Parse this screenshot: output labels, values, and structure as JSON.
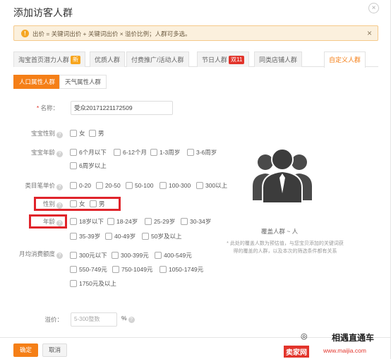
{
  "dialog": {
    "title": "添加访客人群",
    "close_icon": "×"
  },
  "notice": {
    "text": "出价 = 关键词出价 + 关键词出价 × 溢价比例；人群可多选。",
    "close": "×"
  },
  "tabs": [
    {
      "label": "淘宝首页潜力人群",
      "tag": "新",
      "tag_color": "#f7a51d"
    },
    {
      "label": "优质人群"
    },
    {
      "label": "付费推广/活动人群"
    },
    {
      "label": "节日人群",
      "tag": "双11",
      "tag_color": "#e2342b"
    },
    {
      "label": "同类店铺人群"
    },
    {
      "label": "自定义人群",
      "active": true
    }
  ],
  "subtabs": [
    {
      "label": "人口属性人群",
      "active": true
    },
    {
      "label": "天气属性人群"
    }
  ],
  "form": {
    "name_label": "名称：",
    "name_value": "受众20171221172509",
    "baby_gender_label": "宝宝性别",
    "baby_gender_options": [
      "女",
      "男"
    ],
    "baby_age_label": "宝宝年龄",
    "baby_age_options": [
      "6个月以下",
      "6-12个月",
      "1-3周岁",
      "3-6周岁",
      "6周岁以上"
    ],
    "category_price_label": "类目笔单价",
    "category_price_options": [
      "0-20",
      "20-50",
      "50-100",
      "100-300",
      "300以上"
    ],
    "gender_label": "性别",
    "gender_options": [
      "女",
      "男"
    ],
    "age_label": "年龄",
    "age_options": [
      "18岁以下",
      "18-24岁",
      "25-29岁",
      "30-34岁",
      "35-39岁",
      "40-49岁",
      "50岁及以上"
    ],
    "monthly_spend_label": "月均消费额度",
    "monthly_spend_options": [
      "300元以下",
      "300-399元",
      "400-549元",
      "550-749元",
      "750-1049元",
      "1050-1749元",
      "1750元及以上"
    ],
    "bid_label": "溢价：",
    "bid_placeholder": "5-300整数",
    "bid_unit": "%"
  },
  "coverage": {
    "label": "覆盖人群 ~ 人",
    "note": "* 此处的覆盖人数为预估值，与您宝贝添加的关键词获得的覆盖的人群，以及本次的筛选条件都有关系"
  },
  "footer": {
    "confirm": "确定",
    "cancel": "取消"
  },
  "watermark": {
    "logo": "卖家网",
    "url": "www.maijia.com",
    "name": "相遇直通车",
    "chat_icon": "wechat-icon"
  },
  "colors": {
    "accent": "#f57f17",
    "highlight": "#e0242b",
    "notice_bg": "#fbf0dd"
  }
}
